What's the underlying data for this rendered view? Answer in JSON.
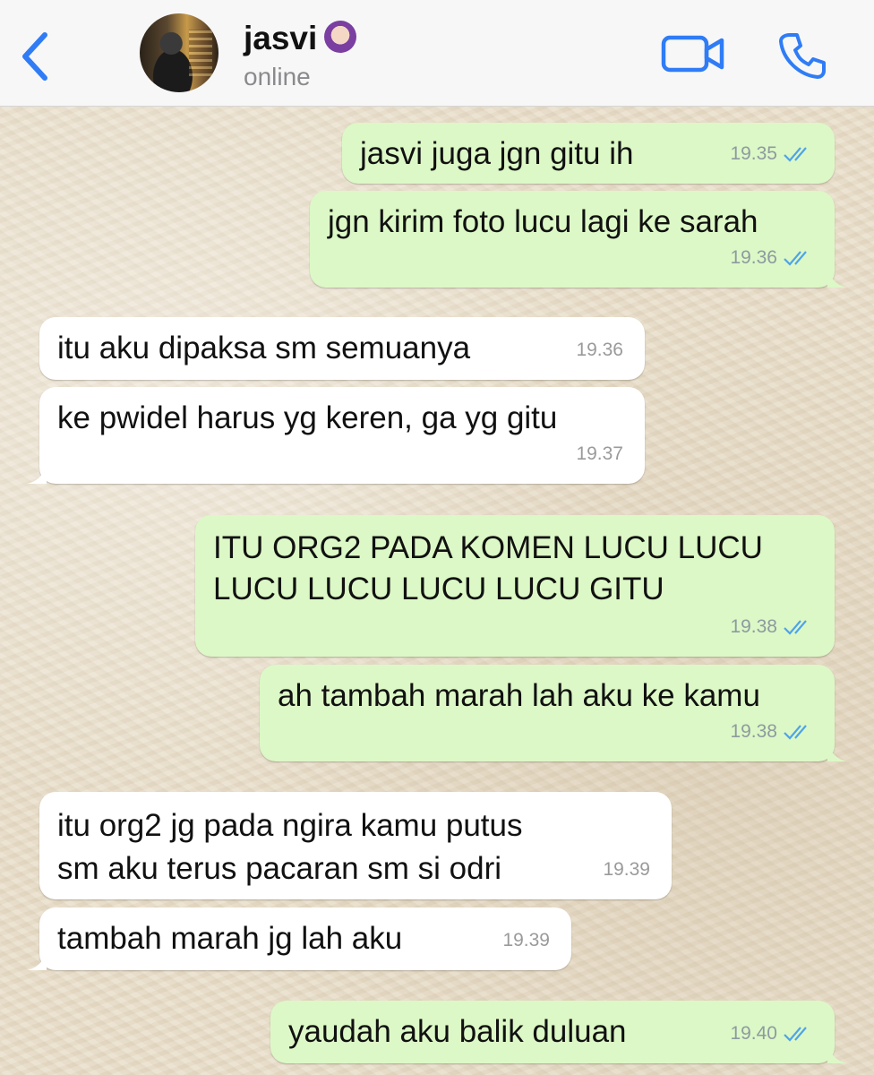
{
  "header": {
    "contact_name": "jasvi",
    "contact_emoji": "🙆🏻‍♀️",
    "status": "online",
    "accent_color": "#2f7cf6"
  },
  "icons": {
    "back": "chevron-left-icon",
    "video": "video-camera-icon",
    "phone": "phone-icon",
    "read": "double-check-icon"
  },
  "messages": [
    {
      "dir": "out",
      "text": "jasvi juga jgn gitu ih",
      "time": "19.35"
    },
    {
      "dir": "out",
      "text": "jgn kirim foto lucu lagi ke sarah",
      "time": "19.36"
    },
    {
      "dir": "in",
      "text": "itu aku dipaksa sm semuanya",
      "time": "19.36"
    },
    {
      "dir": "in",
      "text": "ke pwidel harus yg keren, ga yg gitu",
      "time": "19.37"
    },
    {
      "dir": "out",
      "text": "ITU ORG2 PADA KOMEN LUCU LUCU LUCU LUCU LUCU LUCU GITU",
      "time": "19.38"
    },
    {
      "dir": "out",
      "text": "ah tambah marah lah aku ke kamu",
      "time": "19.38"
    },
    {
      "dir": "in",
      "text": "itu org2 jg pada ngira kamu putus sm aku terus pacaran sm si odri",
      "time": "19.39"
    },
    {
      "dir": "in",
      "text": "tambah marah jg lah aku",
      "time": "19.39"
    },
    {
      "dir": "out",
      "text": "yaudah aku balik duluan",
      "time": "19.40"
    }
  ]
}
